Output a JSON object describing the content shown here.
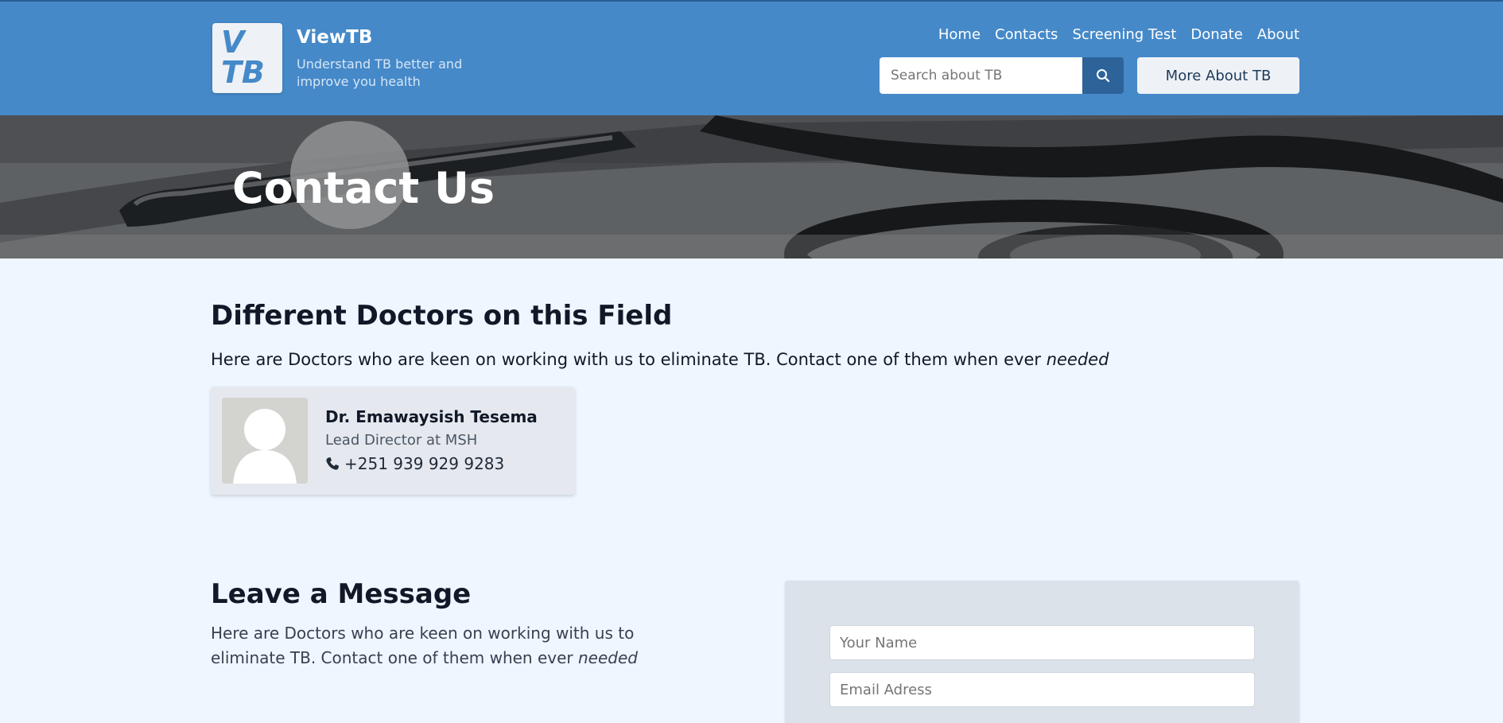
{
  "brand": {
    "logo_line1": "V",
    "logo_line2": "TB",
    "name": "ViewTB",
    "tagline": "Understand TB better and improve you health"
  },
  "nav": {
    "items": [
      "Home",
      "Contacts",
      "Screening Test",
      "Donate",
      "About"
    ]
  },
  "search": {
    "placeholder": "Search about TB",
    "icon": "search-icon"
  },
  "more_button": "More About TB",
  "hero": {
    "title": "Contact Us"
  },
  "doctors_section": {
    "title": "Different Doctors on this Field",
    "description": "Here are Doctors who are keen on working with us to eliminate TB. Contact one of them when ever ",
    "description_emphasis": "needed"
  },
  "doctor": {
    "name": "Dr. Emawaysish Tesema",
    "role": "Lead Director at MSH",
    "phone": "+251 939 929 9283",
    "phone_icon": "phone-icon"
  },
  "message_section": {
    "title": "Leave a Message",
    "description": "Here are Doctors who are keen on working with us to eliminate TB. Contact one of them when ever ",
    "description_emphasis": "needed"
  },
  "form": {
    "name_placeholder": "Your Name",
    "email_placeholder": "Email Adress"
  },
  "colors": {
    "header_bg": "#4589c9",
    "page_bg": "#eff6ff",
    "search_button": "#2d6399"
  }
}
